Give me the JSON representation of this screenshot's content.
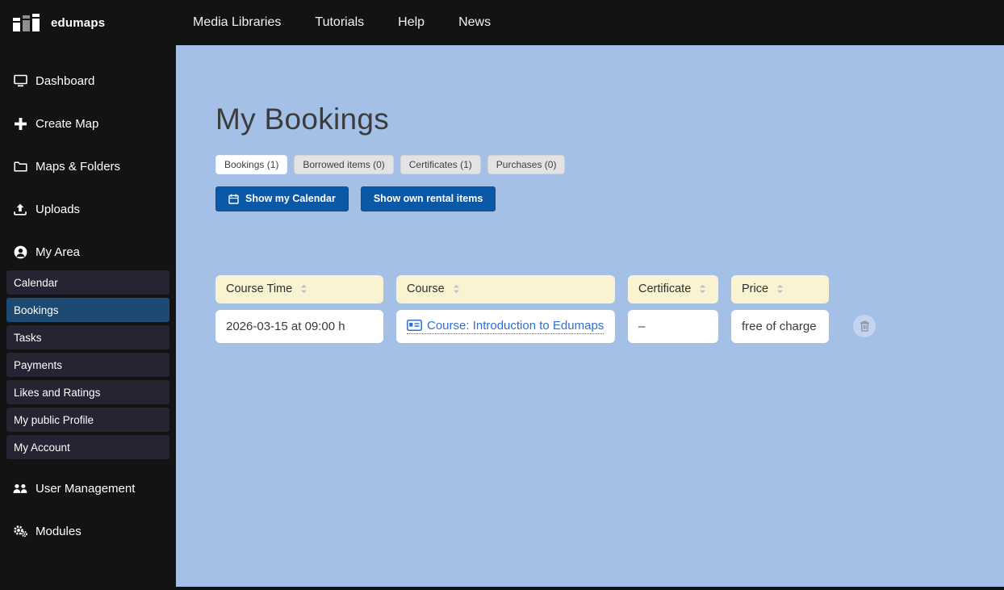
{
  "brand": {
    "name": "edumaps"
  },
  "topnav": {
    "items": [
      {
        "label": "Media Libraries"
      },
      {
        "label": "Tutorials"
      },
      {
        "label": "Help"
      },
      {
        "label": "News"
      }
    ]
  },
  "sidebar": {
    "items": [
      {
        "label": "Dashboard",
        "icon": "dashboard-icon"
      },
      {
        "label": "Create Map",
        "icon": "plus-icon"
      },
      {
        "label": "Maps & Folders",
        "icon": "folder-icon"
      },
      {
        "label": "Uploads",
        "icon": "upload-icon"
      },
      {
        "label": "My Area",
        "icon": "user-circle-icon"
      }
    ],
    "my_area_items": [
      {
        "label": "Calendar",
        "active": false
      },
      {
        "label": "Bookings",
        "active": true
      },
      {
        "label": "Tasks",
        "active": false
      },
      {
        "label": "Payments",
        "active": false
      },
      {
        "label": "Likes and Ratings",
        "active": false
      },
      {
        "label": "My public Profile",
        "active": false
      },
      {
        "label": "My Account",
        "active": false
      }
    ],
    "bottom_items": [
      {
        "label": "User Management",
        "icon": "users-icon"
      },
      {
        "label": "Modules",
        "icon": "cogs-icon"
      }
    ]
  },
  "main": {
    "title": "My Bookings",
    "tabs": [
      {
        "label": "Bookings (1)",
        "active": true
      },
      {
        "label": "Borrowed items (0)",
        "active": false
      },
      {
        "label": "Certificates (1)",
        "active": false
      },
      {
        "label": "Purchases (0)",
        "active": false
      }
    ],
    "actions": {
      "show_calendar": "Show my Calendar",
      "show_rental": "Show own rental items"
    },
    "table": {
      "columns": [
        {
          "label": "Course Time",
          "sortable": true
        },
        {
          "label": "Course",
          "sortable": true
        },
        {
          "label": "Certificate",
          "sortable": true
        },
        {
          "label": "Price",
          "sortable": true
        }
      ],
      "rows": [
        {
          "course_time": "2026-03-15 at 09:00 h",
          "course": "Course: Introduction to Edumaps",
          "certificate": "–",
          "price": "free of charge"
        }
      ]
    }
  },
  "colors": {
    "topbar_bg": "#131313",
    "sidebar_bg": "#131313",
    "subitem_bg": "#252433",
    "subitem_active_bg": "#1c4a73",
    "content_bg": "#a4c0e7",
    "header_cell_bg": "#f9f3d2",
    "primary_button_bg": "#0b59a6",
    "link_color": "#2e6fd8",
    "title_color": "#3c3c3c"
  }
}
